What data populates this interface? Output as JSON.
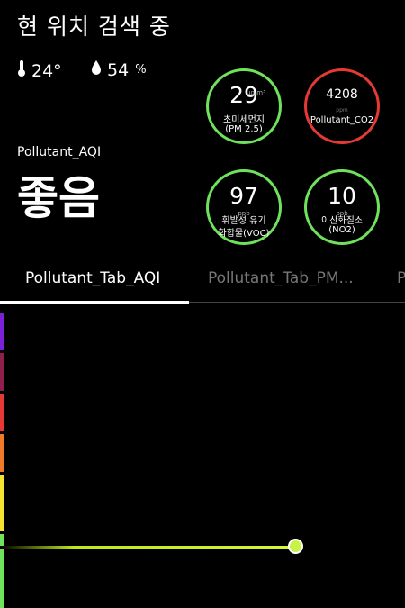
{
  "header": {
    "title": "현 위치 검색 중"
  },
  "weather": {
    "temperature": "24°",
    "humidity": "54",
    "humidity_unit": "%",
    "temp_icon": "thermometer-icon",
    "humidity_icon": "droplet-icon"
  },
  "aqi": {
    "label": "Pollutant_AQI",
    "status": "좋음"
  },
  "gauges": {
    "pm25": {
      "value": "29",
      "unit": "μg/m³",
      "name_line1": "초미세먼지",
      "name_line2": "(PM 2.5)",
      "color": "#6fe25c"
    },
    "co2": {
      "value": "4208",
      "unit": "ppm",
      "name_line1": "Pollutant_CO2",
      "name_line2": "",
      "color": "#e53935"
    },
    "voc": {
      "value": "97",
      "unit": "ppb",
      "name_line1": "휘발성 유기",
      "name_line2": "화합물(VOC)",
      "color": "#6fe25c"
    },
    "no2": {
      "value": "10",
      "unit": "ppb",
      "name_line1": "이산화질소",
      "name_line2": "(NO2)",
      "color": "#6fe25c"
    }
  },
  "tabs": {
    "items": [
      {
        "label": "Pollutant_Tab_AQI",
        "active": true
      },
      {
        "label": "Pollutant_Tab_PM...",
        "active": false
      },
      {
        "label": "P",
        "active": false
      }
    ]
  },
  "scale": {
    "colors": [
      "#7b1fd8",
      "#8e1e4c",
      "#e53935",
      "#f07a2a",
      "#f5e42d",
      "#6fe25c"
    ],
    "current_level": "good"
  }
}
